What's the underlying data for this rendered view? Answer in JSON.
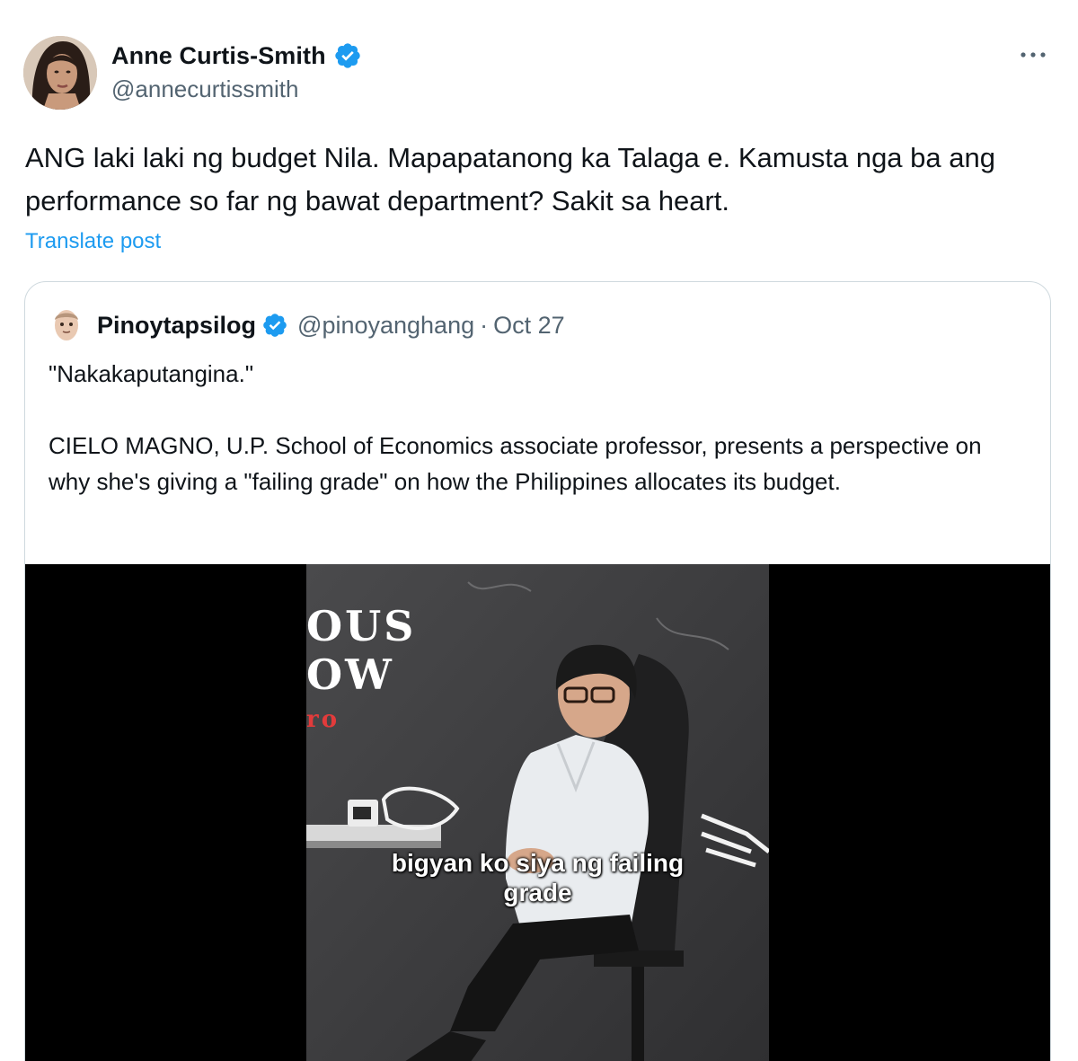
{
  "author": {
    "display_name": "Anne Curtis-Smith",
    "handle": "@annecurtissmith",
    "verified_icon": "verified-badge-icon",
    "verified_color": "#1d9bf0"
  },
  "more_icon": "more-options-icon",
  "tweet": {
    "text": "ANG laki laki ng budget Nila. Mapapatanong ka Talaga e. Kamusta nga ba ang performance so far ng bawat department? Sakit sa heart.",
    "translate_label": "Translate post"
  },
  "quote": {
    "display_name": "Pinoytapsilog",
    "handle": "@pinoyanghang",
    "separator": "·",
    "date": "Oct 27",
    "text_line1": "\"Nakakaputangina.\"",
    "text_body": "CIELO MAGNO, U.P. School of Economics associate professor, presents a perspective on why she's giving a \"failing grade\" on how the Philippines allocates its budget.",
    "media": {
      "bg_text_1": "OUS",
      "bg_text_2": "OW",
      "bg_text_3": "ro",
      "subtitle_line1": "bigyan ko siya ng failing",
      "subtitle_line2": "grade"
    }
  },
  "colors": {
    "text_primary": "#0f1419",
    "text_secondary": "#536471",
    "link": "#1d9bf0",
    "border": "#cfd9de"
  }
}
